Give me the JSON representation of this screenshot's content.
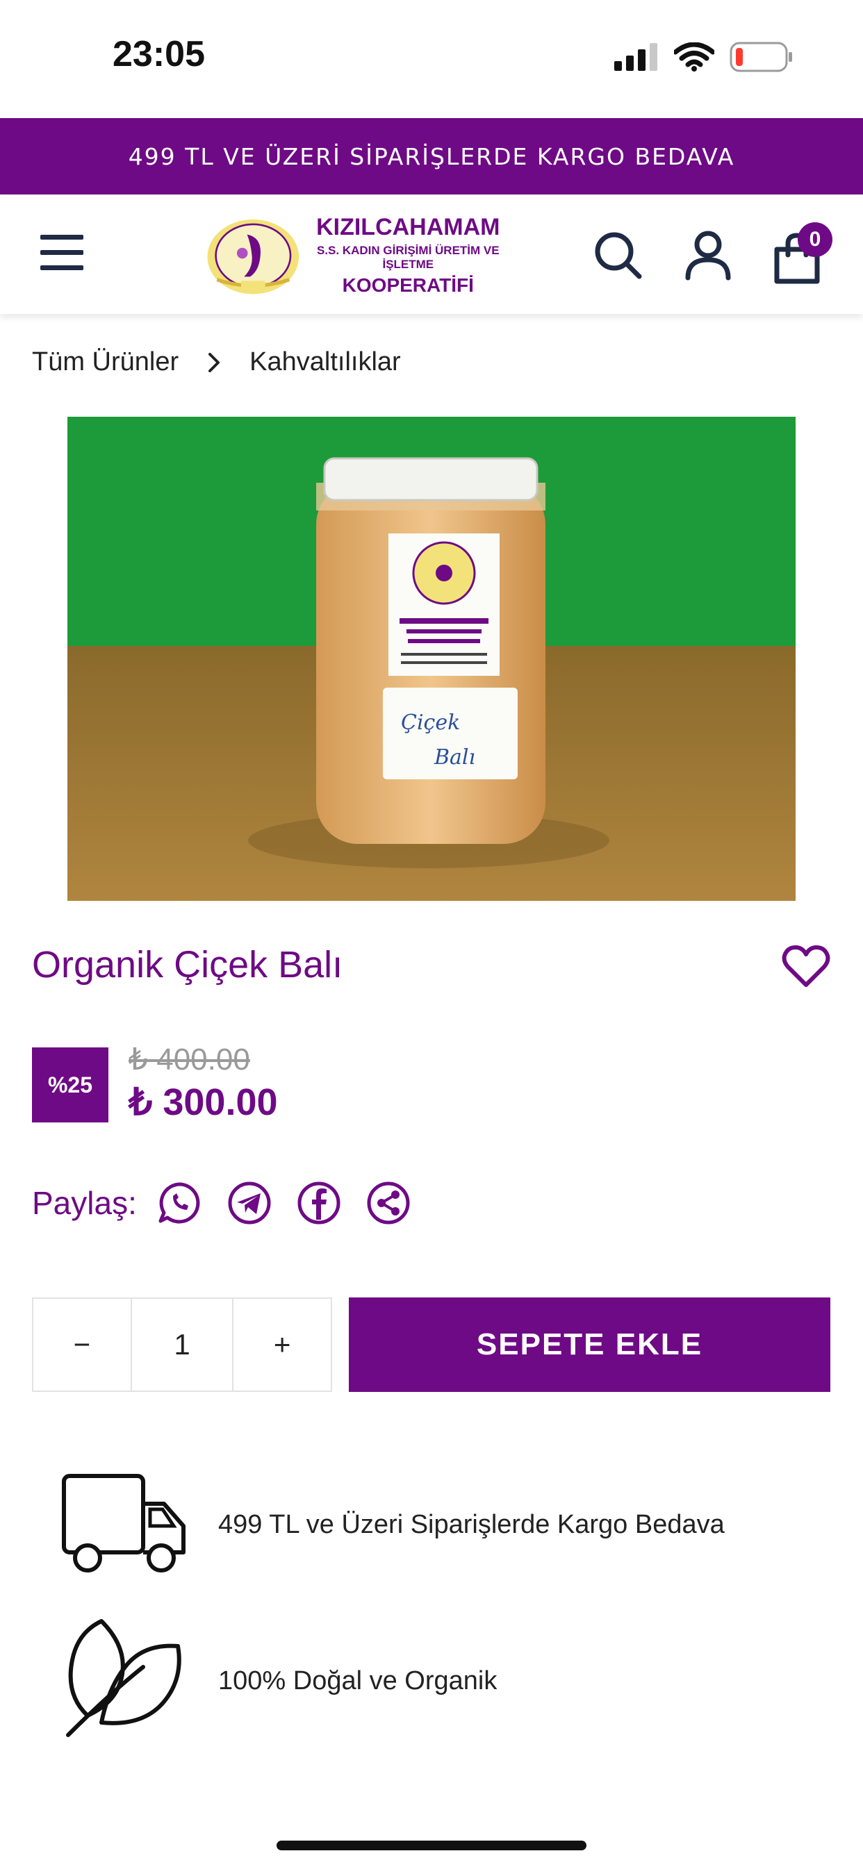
{
  "status": {
    "time": "23:05",
    "icons": [
      "cellular-signal-icon",
      "wifi-icon",
      "battery-low-icon"
    ]
  },
  "promo": {
    "text": "499 TL VE ÜZERİ SİPARİŞLERDE KARGO BEDAVA"
  },
  "header": {
    "logo": {
      "line1": "KIZILCAHAMAM",
      "line2": "S.S. KADIN GİRİŞİMİ ÜRETİM VE İŞLETME",
      "line3": "KOOPERATİFİ"
    },
    "icons": [
      "menu-icon",
      "search-icon",
      "user-icon",
      "shopping-bag-icon"
    ],
    "cart_count": "0"
  },
  "breadcrumb": {
    "items": [
      "Tüm Ürünler",
      "Kahvaltılıklar"
    ]
  },
  "product": {
    "title": "Organik Çiçek Balı",
    "image_label": "Çiçek Balı",
    "discount": "%25",
    "old_price": "₺ 400.00",
    "price": "₺ 300.00"
  },
  "share": {
    "label": "Paylaş:",
    "icons": [
      "whatsapp-icon",
      "telegram-icon",
      "facebook-icon",
      "share-icon"
    ]
  },
  "cart": {
    "minus": "−",
    "quantity": "1",
    "plus": "+",
    "add_label": "SEPETE EKLE"
  },
  "features": [
    {
      "icon": "truck-icon",
      "text": "499 TL ve Üzeri Siparişlerde Kargo Bedava"
    },
    {
      "icon": "leaf-icon",
      "text": "100% Doğal ve Organik"
    }
  ],
  "colors": {
    "brand": "#6e0a85",
    "dark": "#1f2a44"
  }
}
